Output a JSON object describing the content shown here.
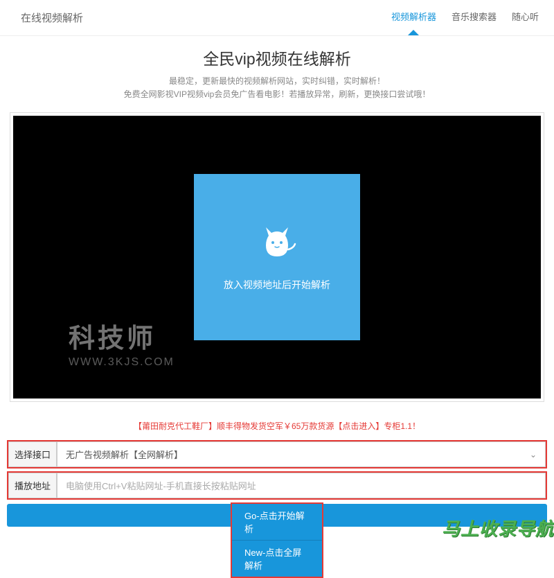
{
  "header": {
    "brand": "在线视频解析",
    "nav": [
      {
        "label": "视频解析器",
        "active": true
      },
      {
        "label": "音乐搜索器",
        "active": false
      },
      {
        "label": "随心听",
        "active": false
      }
    ]
  },
  "title": {
    "main": "全民vip视频在线解析",
    "line1": "最稳定，更新最快的视频解析网站，实时纠错，实时解析！",
    "line2": "免费全网影视VIP视频vip会员免广告看电影！若播放异常，刷新，更换接口尝试哦！"
  },
  "player": {
    "placeholder_text": "放入视频地址后开始解析",
    "watermark_main": "科技师",
    "watermark_sub": "WWW.3KJS.COM"
  },
  "promo": "【莆田耐克代工鞋厂】顺丰得物发货空军￥65万款货源【点击进入】专柜1.1！",
  "form": {
    "interface_label": "选择接口",
    "interface_value": "无广告视频解析【全网解析】",
    "url_label": "播放地址",
    "url_placeholder": "电脑使用Ctrl+V粘贴网址-手机直接长按粘贴网址"
  },
  "buttons": {
    "go": "Go-点击开始解析",
    "new": "New-点击全屏解析"
  },
  "corner": "马上收录导航"
}
